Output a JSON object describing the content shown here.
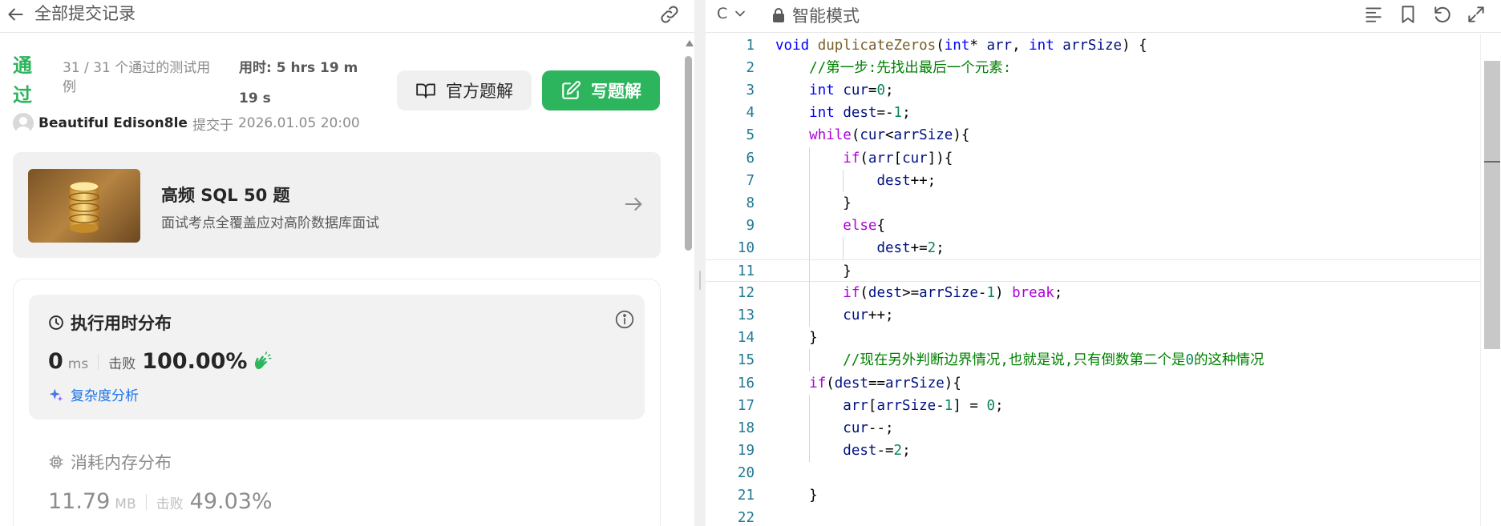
{
  "header": {
    "back_icon": "arrow-left-icon",
    "title": "全部提交记录",
    "link_icon": "link-icon"
  },
  "submission": {
    "status": "通过",
    "testcases": "31 / 31 个通过的测试用例",
    "runtime_summary": "用时: 5 hrs 19 m 19 s",
    "author": "Beautiful Edison8le",
    "submitted_label": "提交于",
    "submitted_time": "2026.01.05 20:00",
    "status_color": "#2db55d"
  },
  "buttons": {
    "official_solution": "官方题解",
    "official_solution_icon": "book-open-icon",
    "write_solution": "写题解",
    "write_solution_icon": "edit-icon"
  },
  "promo": {
    "title": "高频 SQL 50 题",
    "subtitle": "面试考点全覆盖应对高阶数据库面试",
    "image_icon": "database-icon",
    "arrow_icon": "arrow-right-icon"
  },
  "runtime": {
    "title": "执行用时分布",
    "value": "0",
    "unit": "ms",
    "beats_label": "击败",
    "beats": "100.00%",
    "complexity_link": "复杂度分析"
  },
  "memory": {
    "title": "消耗内存分布",
    "value": "11.79",
    "unit": "MB",
    "beats_label": "击败",
    "beats": "49.03%"
  },
  "editor": {
    "language": "C",
    "mode": "智能模式",
    "toolbar_icons": [
      "format-icon",
      "bookmark-icon",
      "undo-icon",
      "expand-icon"
    ],
    "active_line": 11,
    "lines": [
      {
        "n": "1",
        "tokens": [
          [
            "tk-type",
            "void"
          ],
          [
            "tk-op",
            " "
          ],
          [
            "tk-fn",
            "duplicateZeros"
          ],
          [
            "tk-op",
            "("
          ],
          [
            "tk-type",
            "int"
          ],
          [
            "tk-op",
            "* "
          ],
          [
            "tk-var",
            "arr"
          ],
          [
            "tk-op",
            ", "
          ],
          [
            "tk-type",
            "int"
          ],
          [
            "tk-op",
            " "
          ],
          [
            "tk-var",
            "arrSize"
          ],
          [
            "tk-op",
            ") {"
          ]
        ]
      },
      {
        "n": "2",
        "tokens": [
          [
            "tk-op",
            "    "
          ],
          [
            "tk-cmt",
            "//第一步:先找出最后一个元素:"
          ]
        ]
      },
      {
        "n": "3",
        "tokens": [
          [
            "tk-op",
            "    "
          ],
          [
            "tk-type",
            "int"
          ],
          [
            "tk-op",
            " "
          ],
          [
            "tk-var",
            "cur"
          ],
          [
            "tk-op",
            "="
          ],
          [
            "tk-num",
            "0"
          ],
          [
            "tk-op",
            ";"
          ]
        ]
      },
      {
        "n": "4",
        "tokens": [
          [
            "tk-op",
            "    "
          ],
          [
            "tk-type",
            "int"
          ],
          [
            "tk-op",
            " "
          ],
          [
            "tk-var",
            "dest"
          ],
          [
            "tk-op",
            "=-"
          ],
          [
            "tk-num",
            "1"
          ],
          [
            "tk-op",
            ";"
          ]
        ]
      },
      {
        "n": "5",
        "tokens": [
          [
            "tk-op",
            "    "
          ],
          [
            "tk-kw",
            "while"
          ],
          [
            "tk-op",
            "("
          ],
          [
            "tk-var",
            "cur"
          ],
          [
            "tk-op",
            "<"
          ],
          [
            "tk-var",
            "arrSize"
          ],
          [
            "tk-op",
            "){"
          ]
        ]
      },
      {
        "n": "6",
        "tokens": [
          [
            "tk-op",
            "        "
          ],
          [
            "tk-kw",
            "if"
          ],
          [
            "tk-op",
            "("
          ],
          [
            "tk-var",
            "arr"
          ],
          [
            "tk-op",
            "["
          ],
          [
            "tk-var",
            "cur"
          ],
          [
            "tk-op",
            "]){"
          ]
        ]
      },
      {
        "n": "7",
        "tokens": [
          [
            "tk-op",
            "            "
          ],
          [
            "tk-var",
            "dest"
          ],
          [
            "tk-op",
            "++;"
          ]
        ]
      },
      {
        "n": "8",
        "tokens": [
          [
            "tk-op",
            "        }"
          ]
        ]
      },
      {
        "n": "9",
        "tokens": [
          [
            "tk-op",
            "        "
          ],
          [
            "tk-kw",
            "else"
          ],
          [
            "tk-op",
            "{"
          ]
        ]
      },
      {
        "n": "10",
        "tokens": [
          [
            "tk-op",
            "            "
          ],
          [
            "tk-var",
            "dest"
          ],
          [
            "tk-op",
            "+="
          ],
          [
            "tk-num",
            "2"
          ],
          [
            "tk-op",
            ";"
          ]
        ]
      },
      {
        "n": "11",
        "tokens": [
          [
            "tk-op",
            "        }"
          ]
        ]
      },
      {
        "n": "12",
        "tokens": [
          [
            "tk-op",
            "        "
          ],
          [
            "tk-kw",
            "if"
          ],
          [
            "tk-op",
            "("
          ],
          [
            "tk-var",
            "dest"
          ],
          [
            "tk-op",
            ">="
          ],
          [
            "tk-var",
            "arrSize"
          ],
          [
            "tk-op",
            "-"
          ],
          [
            "tk-num",
            "1"
          ],
          [
            "tk-op",
            ") "
          ],
          [
            "tk-kw",
            "break"
          ],
          [
            "tk-op",
            ";"
          ]
        ]
      },
      {
        "n": "13",
        "tokens": [
          [
            "tk-op",
            "        "
          ],
          [
            "tk-var",
            "cur"
          ],
          [
            "tk-op",
            "++;"
          ]
        ]
      },
      {
        "n": "14",
        "tokens": [
          [
            "tk-op",
            "    }"
          ]
        ]
      },
      {
        "n": "15",
        "tokens": [
          [
            "tk-op",
            "        "
          ],
          [
            "tk-cmt",
            "//现在另外判断边界情况,也就是说,只有倒数第二个是"
          ],
          [
            "tk-num",
            "0"
          ],
          [
            "tk-cmt",
            "的这种情况"
          ]
        ]
      },
      {
        "n": "16",
        "tokens": [
          [
            "tk-op",
            "    "
          ],
          [
            "tk-kw",
            "if"
          ],
          [
            "tk-op",
            "("
          ],
          [
            "tk-var",
            "dest"
          ],
          [
            "tk-op",
            "=="
          ],
          [
            "tk-var",
            "arrSize"
          ],
          [
            "tk-op",
            "){"
          ]
        ]
      },
      {
        "n": "17",
        "tokens": [
          [
            "tk-op",
            "        "
          ],
          [
            "tk-var",
            "arr"
          ],
          [
            "tk-op",
            "["
          ],
          [
            "tk-var",
            "arrSize"
          ],
          [
            "tk-op",
            "-"
          ],
          [
            "tk-num",
            "1"
          ],
          [
            "tk-op",
            "] = "
          ],
          [
            "tk-num",
            "0"
          ],
          [
            "tk-op",
            ";"
          ]
        ]
      },
      {
        "n": "18",
        "tokens": [
          [
            "tk-op",
            "        "
          ],
          [
            "tk-var",
            "cur"
          ],
          [
            "tk-op",
            "--;"
          ]
        ]
      },
      {
        "n": "19",
        "tokens": [
          [
            "tk-op",
            "        "
          ],
          [
            "tk-var",
            "dest"
          ],
          [
            "tk-op",
            "-="
          ],
          [
            "tk-num",
            "2"
          ],
          [
            "tk-op",
            ";"
          ]
        ]
      },
      {
        "n": "20",
        "tokens": []
      },
      {
        "n": "21",
        "tokens": [
          [
            "tk-op",
            "    }"
          ]
        ]
      },
      {
        "n": "22",
        "tokens": []
      }
    ]
  }
}
